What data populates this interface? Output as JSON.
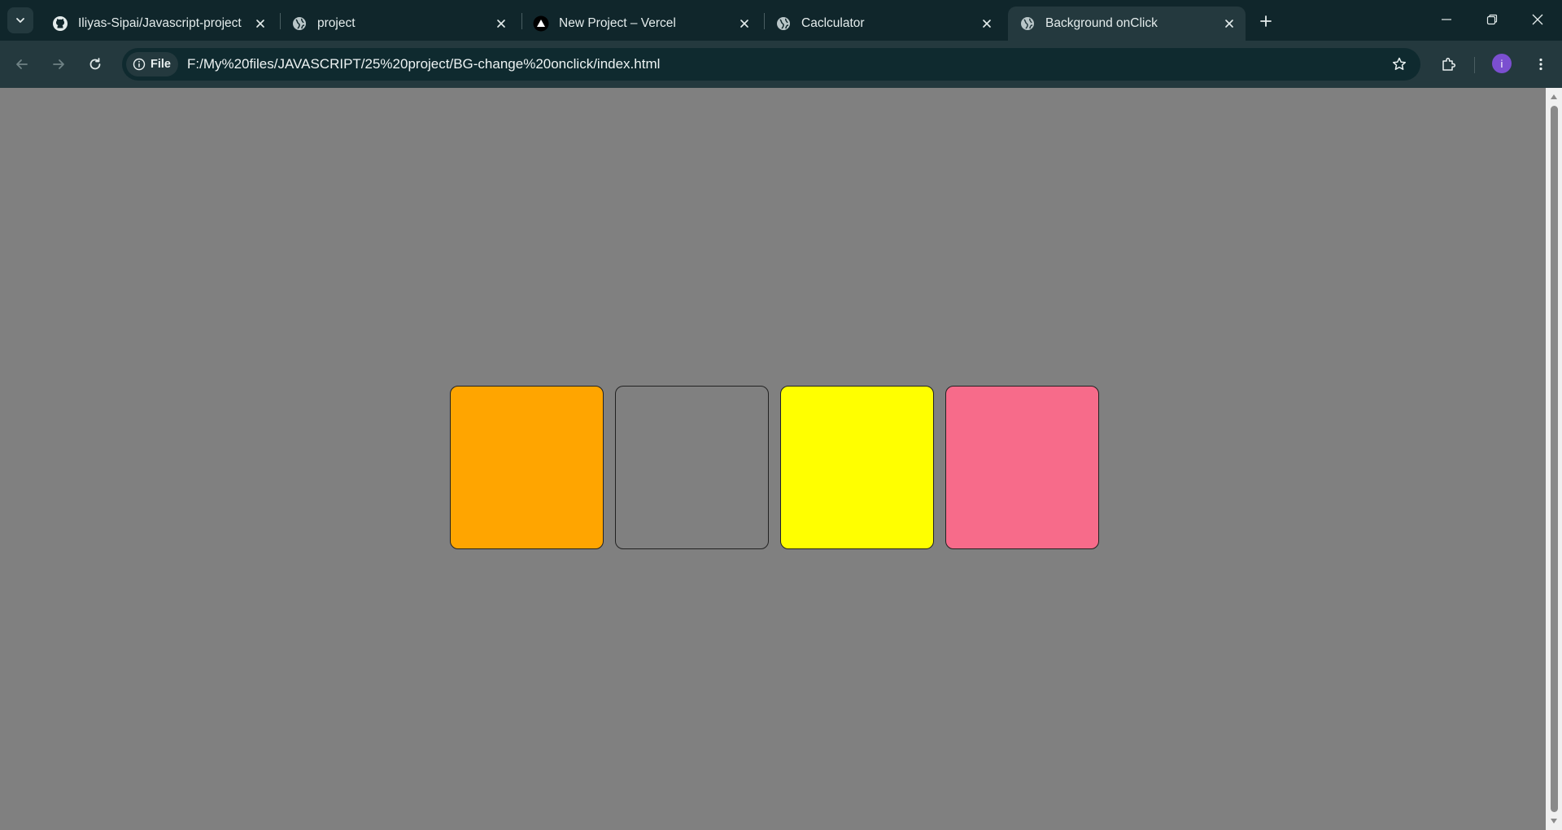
{
  "browser": {
    "tabs": [
      {
        "title": "Iliyas-Sipai/Javascript-project",
        "icon": "github-icon",
        "active": false
      },
      {
        "title": "project",
        "icon": "globe-icon",
        "active": false
      },
      {
        "title": "New Project – Vercel",
        "icon": "vercel-icon",
        "active": false
      },
      {
        "title": "Caclculator",
        "icon": "globe-icon",
        "active": false
      },
      {
        "title": "Background onClick",
        "icon": "globe-icon",
        "active": true
      }
    ],
    "address_bar": {
      "chip_label": "File",
      "url": "F:/My%20files/JAVASCRIPT/25%20project/BG-change%20onclick/index.html"
    },
    "profile_initial": "i",
    "colors": {
      "tabstrip": "#10262b",
      "toolbar": "#24393e",
      "avatar": "#7b4fd0"
    }
  },
  "page": {
    "background": "#808080",
    "boxes": [
      {
        "name": "orange-box",
        "color": "#ffa500"
      },
      {
        "name": "grey-box",
        "color": "#808080"
      },
      {
        "name": "yellow-box",
        "color": "#ffff00"
      },
      {
        "name": "pink-box",
        "color": "#f76b8a"
      }
    ]
  }
}
